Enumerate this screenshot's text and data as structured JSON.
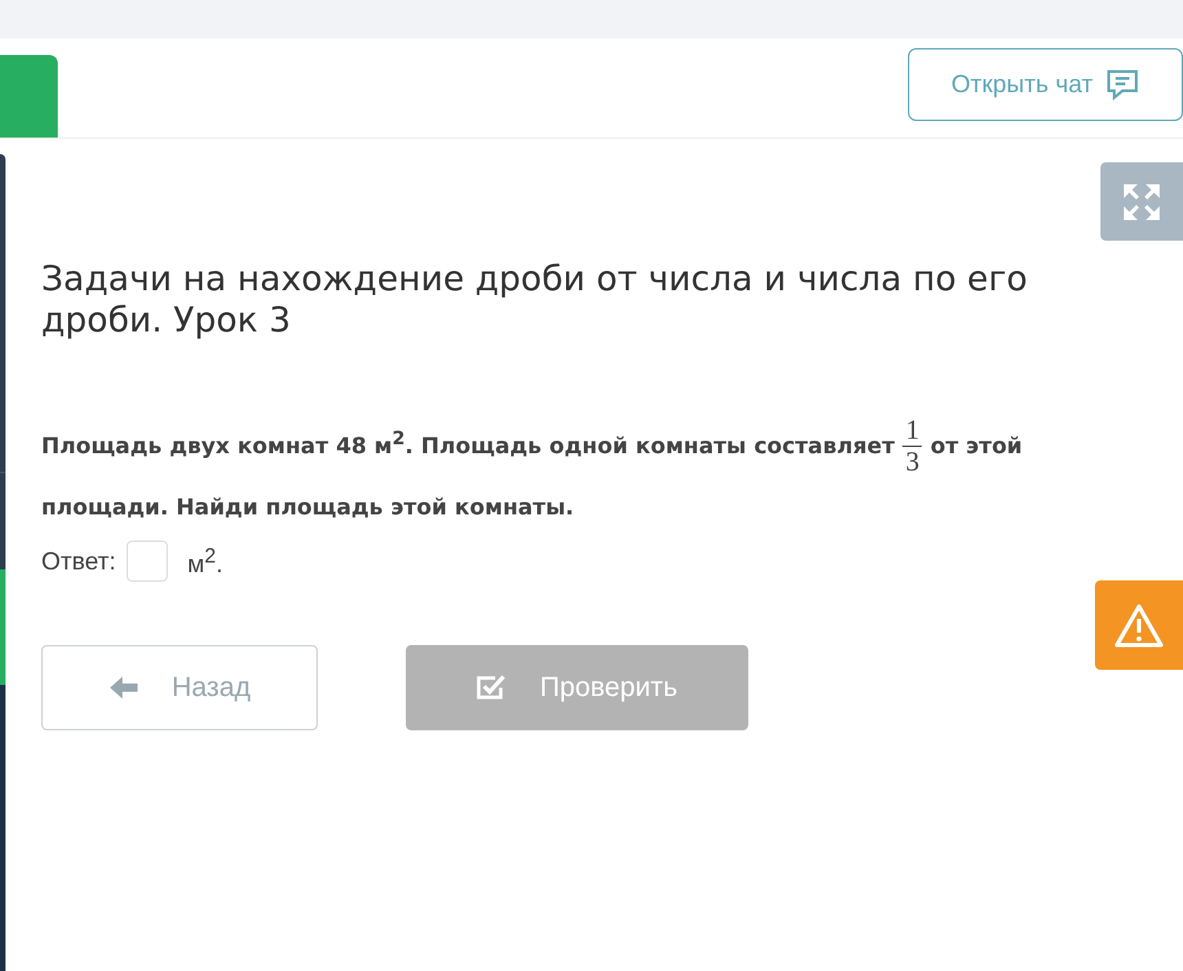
{
  "header": {
    "chat_button": "Открыть чат"
  },
  "lesson": {
    "title": "Задачи на нахождение дроби от числа и числа по его дроби. Урок 3"
  },
  "problem": {
    "before": "Площадь двух комнат 48 м$^{2}$. Площадь одной комнаты составляет",
    "fraction": {
      "numerator": "1",
      "denominator": "3"
    },
    "after": "от этой площади. Найди площадь этой комнаты."
  },
  "answer": {
    "label": "Ответ:",
    "unit": "м$^{2}$."
  },
  "buttons": [
    {
      "kind": "back",
      "label": "Назад",
      "disabled": false
    },
    {
      "kind": "check",
      "label": "Проверить",
      "disabled": true
    }
  ]
}
